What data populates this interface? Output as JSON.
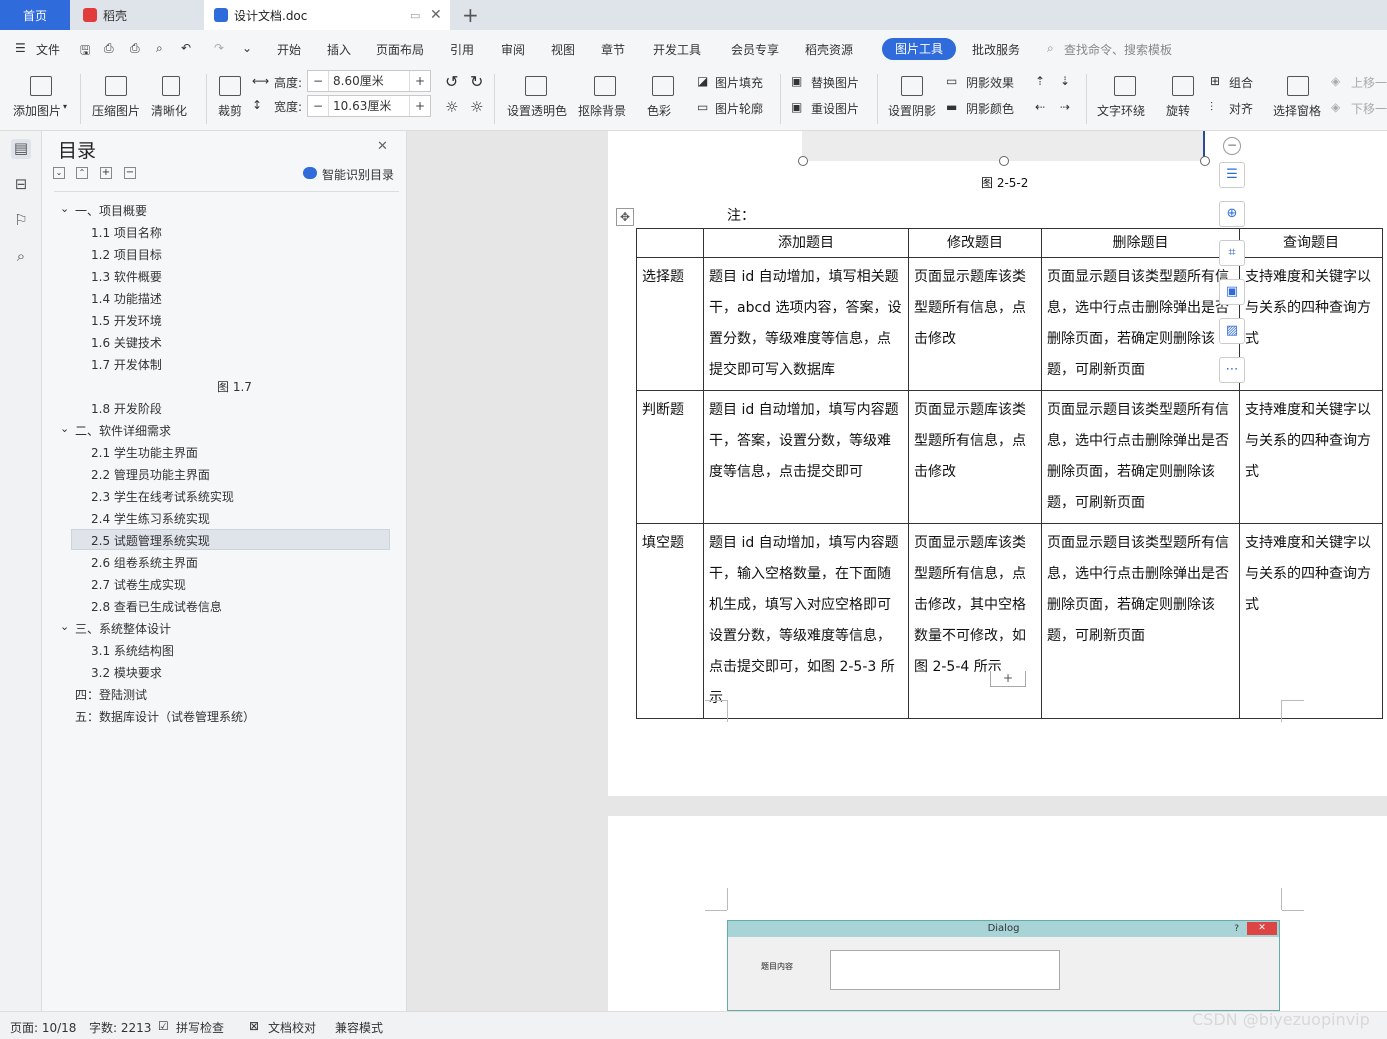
{
  "tabs": {
    "home": "首页",
    "daoke": "稻壳",
    "doc": "设计文档.doc",
    "new_tab": "+"
  },
  "menu": {
    "file": "文件",
    "items": [
      "开始",
      "插入",
      "页面布局",
      "引用",
      "审阅",
      "视图",
      "章节",
      "开发工具",
      "会员专享",
      "稻壳资源"
    ],
    "picture_tools": "图片工具",
    "pizhu": "批改服务",
    "search": "查找命令、搜索模板"
  },
  "ribbon": {
    "add_image": "添加图片",
    "compress": "压缩图片",
    "sharpen": "清晰化",
    "crop": "裁剪",
    "height_label": "高度:",
    "height_value": "8.60厘米",
    "width_label": "宽度:",
    "width_value": "10.63厘米",
    "transparent": "设置透明色",
    "remove_bg": "抠除背景",
    "color": "色彩",
    "fill": "图片填充",
    "outline": "图片轮廓",
    "replace": "替换图片",
    "reset": "重设图片",
    "shadow_set": "设置阴影",
    "shadow_effect": "阴影效果",
    "shadow_color": "阴影颜色",
    "wrap": "文字环绕",
    "rotate": "旋转",
    "group": "组合",
    "align": "对齐",
    "select_pane": "选择窗格",
    "bring_up": "上移一",
    "send_down": "下移一"
  },
  "toc": {
    "title": "目录",
    "smart": "智能识别目录",
    "items": [
      "一、项目概要",
      "1.1 项目名称",
      "1.2 项目目标",
      "1.3 软件概要",
      "1.4 功能描述",
      "1.5 开发环境",
      "1.6 关键技术",
      "1.7 开发体制",
      "图 1.7",
      "1.8 开发阶段",
      "二、软件详细需求",
      "2.1 学生功能主界面",
      "2.2 管理员功能主界面",
      "2.3  学生在线考试系统实现",
      "2.4  学生练习系统实现",
      "2.5 试题管理系统实现",
      "2.6 组卷系统主界面",
      "2.7  试卷生成实现",
      "2.8 查看已生成试卷信息",
      "三、系统整体设计",
      "3.1 系统结构图",
      "3.2 模块要求",
      "四：登陆测试",
      "五：数据库设计（试卷管理系统）"
    ]
  },
  "doc": {
    "figure_caption": "图 2-5-2",
    "note": "注：",
    "table": {
      "headers": [
        "",
        "添加题目",
        "修改题目",
        "删除题目",
        "查询题目"
      ],
      "rows": [
        [
          "选择题",
          "题目 id 自动增加，填写相关题干，abcd 选项内容，答案，设置分数，等级难度等信息，点提交即可写入数据库",
          "页面显示题库该类型题所有信息，点击修改",
          "页面显示题目该类型题所有信息，选中行点击删除弹出是否删除页面，若确定则删除该题，可刷新页面",
          "支持难度和关键字以与关系的四种查询方式"
        ],
        [
          "判断题",
          "题目 id 自动增加，填写内容题干，答案，设置分数，等级难度等信息，点击提交即可",
          "页面显示题库该类型题所有信息，点击修改",
          "页面显示题目该类型题所有信息，选中行点击删除弹出是否删除页面，若确定则删除该题，可刷新页面",
          "支持难度和关键字以与关系的四种查询方式"
        ],
        [
          "填空题",
          "题目 id 自动增加，填写内容题干，输入空格数量，在下面随机生成，填写入对应空格即可设置分数，等级难度等信息，点击提交即可，如图 2-5-3 所示",
          "页面显示题库该类型题所有信息，点击修改，其中空格数量不可修改，如图 2-5-4 所示",
          "页面显示题目该类型题所有信息，选中行点击删除弹出是否删除页面，若确定则删除该题，可刷新页面",
          "支持难度和关键字以与关系的四种查询方式"
        ]
      ]
    },
    "add_row": "+",
    "dialog": {
      "title": "Dialog",
      "help": "?",
      "close": "✕",
      "label": "题目内容"
    }
  },
  "status": {
    "page": "页面: 10/18",
    "words": "字数: 2213",
    "spell": "拼写检查",
    "proof": "文档校对",
    "compat": "兼容模式"
  },
  "watermark": "CSDN @biyezuopinvip"
}
